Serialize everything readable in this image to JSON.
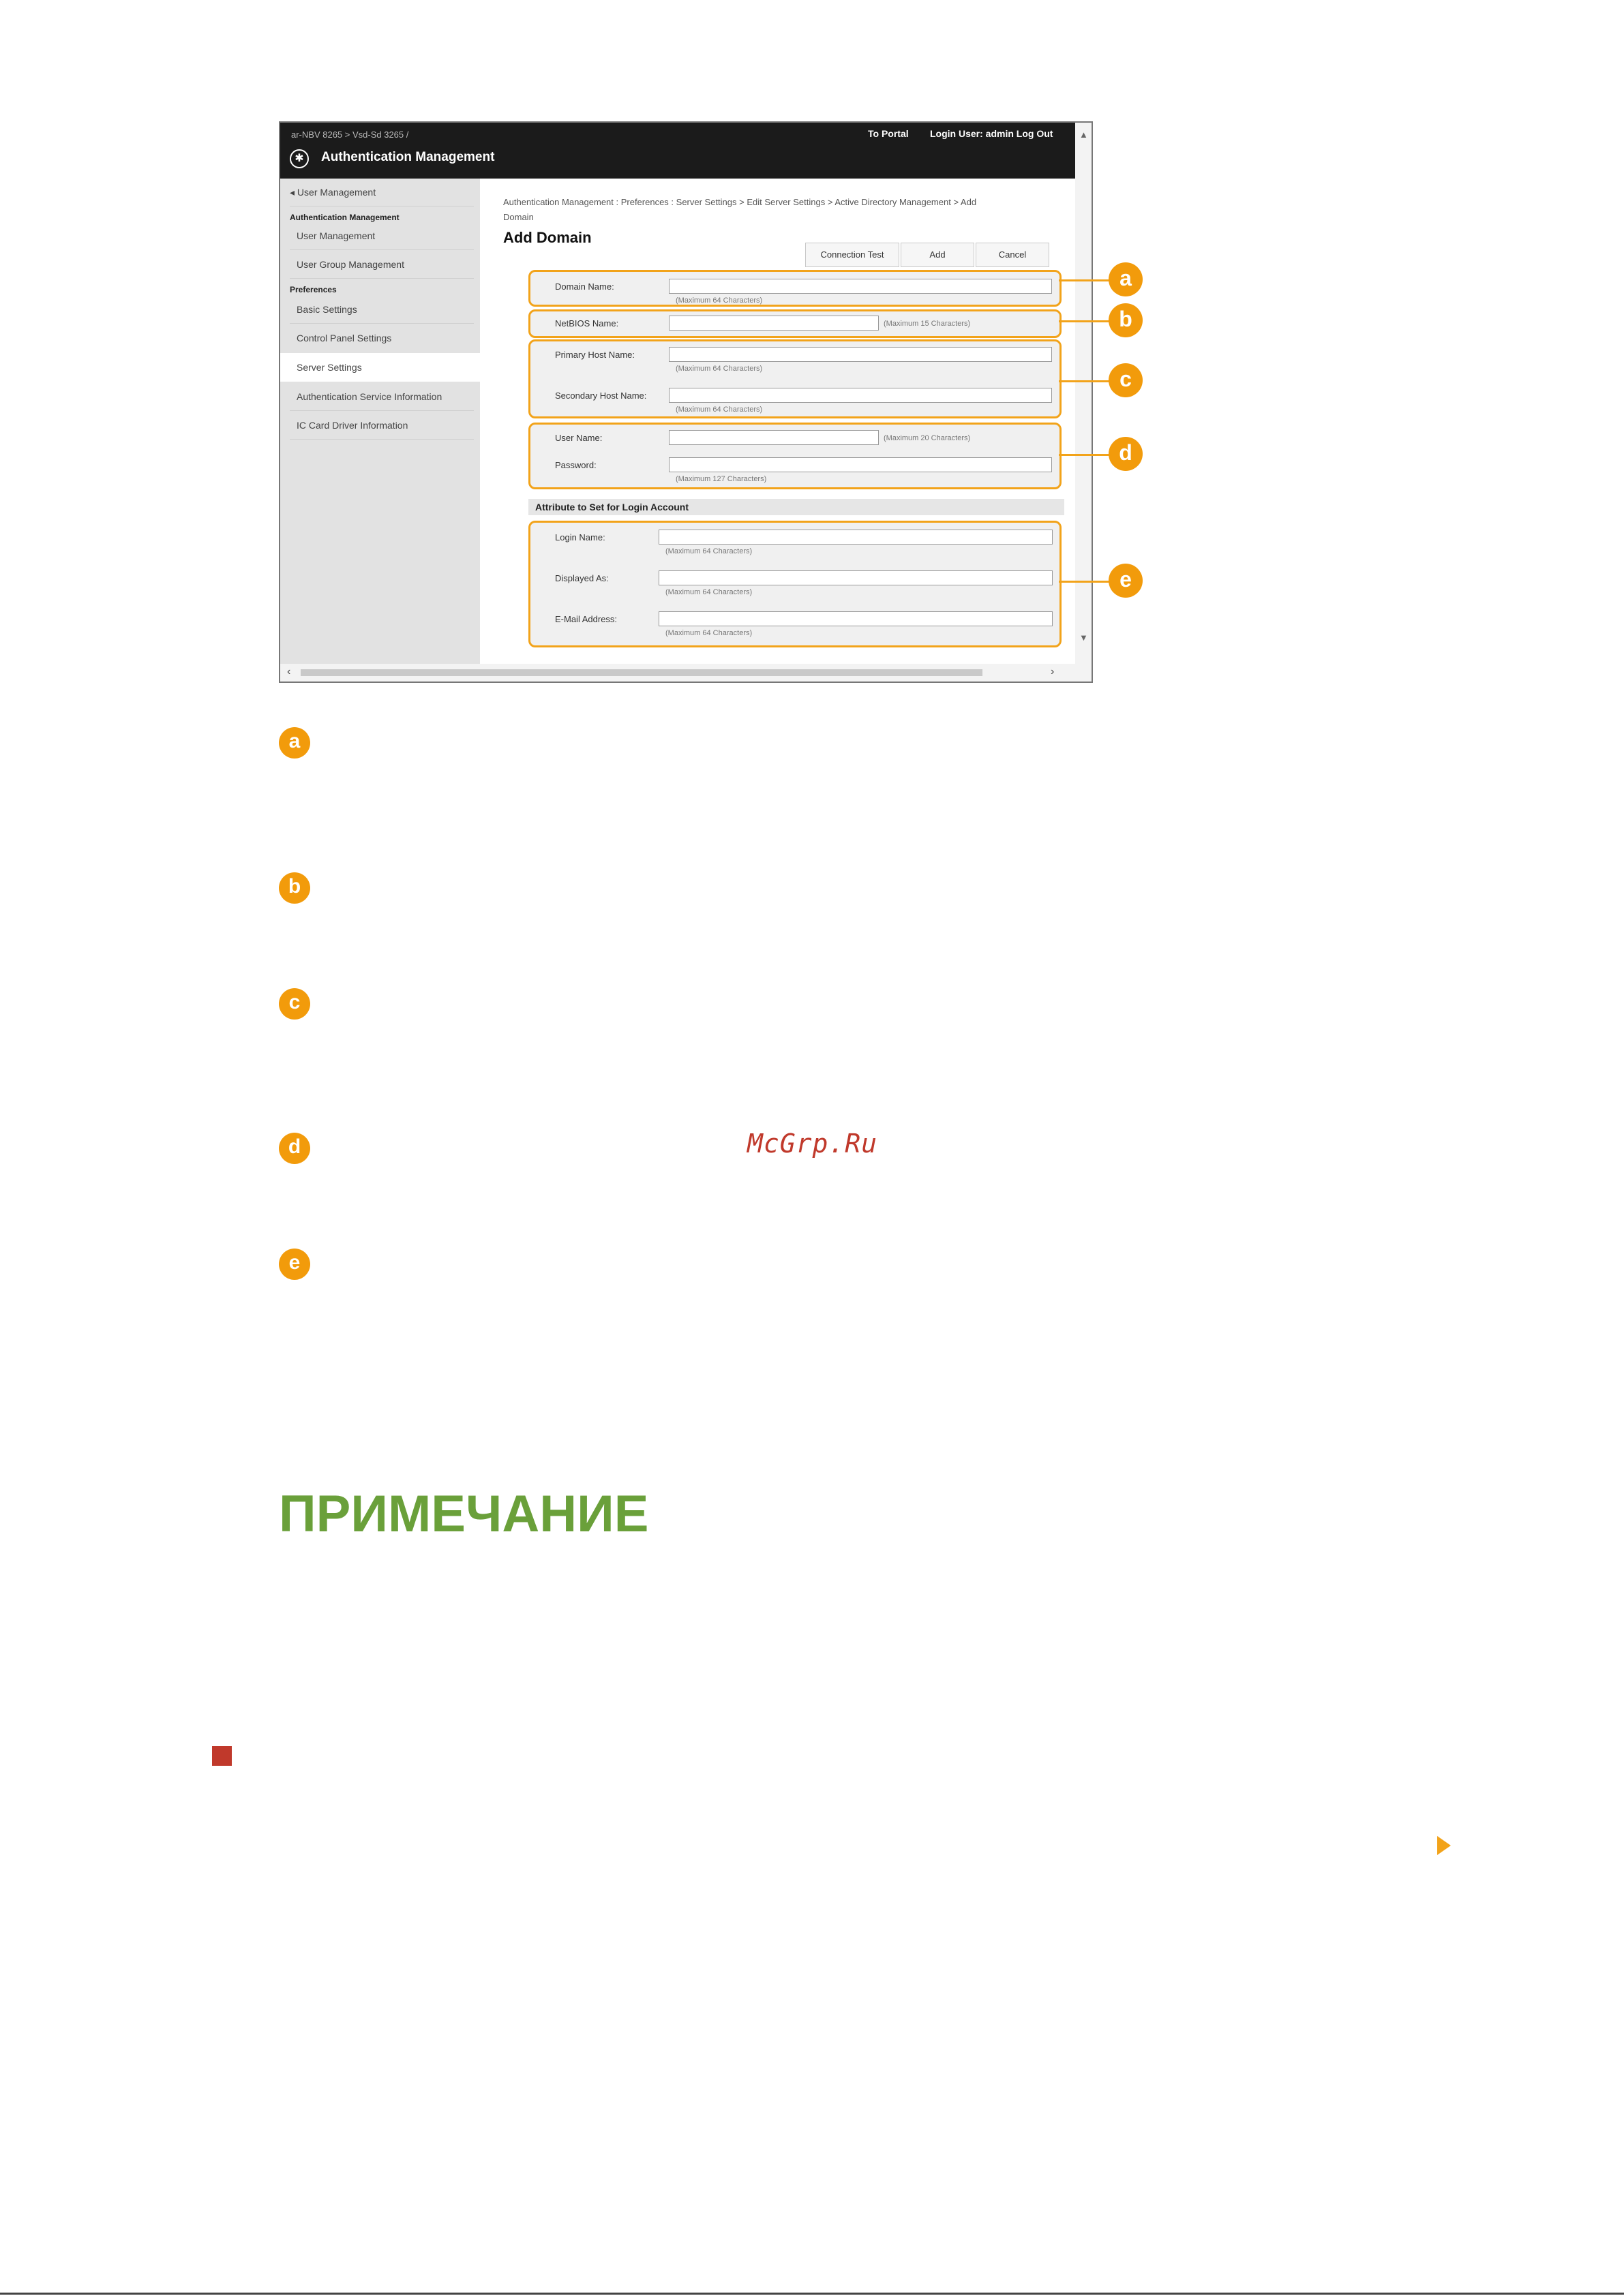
{
  "screenshot": {
    "topbar": {
      "crumb": "ar-NBV 8265 > Vsd-Sd 3265 /",
      "portal_link": "To Portal",
      "login_text": "Login User: admin Log Out",
      "app_title": "Authentication Management"
    },
    "sidebar": {
      "back_link": "User Management",
      "section_auth": "Authentication Management",
      "section_prefs": "Preferences",
      "items": [
        {
          "label": "User Management"
        },
        {
          "label": "User Group Management"
        },
        {
          "label": "Basic Settings"
        },
        {
          "label": "Control Panel Settings"
        },
        {
          "label": "Server Settings"
        },
        {
          "label": "Authentication Service Information"
        },
        {
          "label": "IC Card Driver Information"
        }
      ]
    },
    "main": {
      "breadcrumb": "Authentication Management : Preferences : Server Settings > Edit Server Settings > Active Directory Management > Add Domain",
      "title": "Add Domain",
      "buttons": {
        "connection_test": "Connection Test",
        "add": "Add",
        "cancel": "Cancel"
      },
      "fields": {
        "domain_name": {
          "label": "Domain Name:",
          "note": "(Maximum 64 Characters)"
        },
        "netbios_name": {
          "label": "NetBIOS Name:",
          "note": "(Maximum 15 Characters)"
        },
        "primary_host": {
          "label": "Primary Host Name:",
          "note": "(Maximum 64 Characters)"
        },
        "secondary_host": {
          "label": "Secondary Host Name:",
          "note": "(Maximum 64 Characters)"
        },
        "user_name": {
          "label": "User Name:",
          "note": "(Maximum 20 Characters)"
        },
        "password": {
          "label": "Password:",
          "note": "(Maximum 127 Characters)"
        },
        "login_name": {
          "label": "Login Name:",
          "note": "(Maximum 64 Characters)"
        },
        "displayed_as": {
          "label": "Displayed As:",
          "note": "(Maximum 64 Characters)"
        },
        "email": {
          "label": "E-Mail Address:",
          "note": "(Maximum 64 Characters)"
        }
      },
      "section_login_attr": "Attribute to Set for Login Account"
    },
    "callouts": [
      "a",
      "b",
      "c",
      "d",
      "e"
    ]
  },
  "document": {
    "markers": [
      "a",
      "b",
      "c",
      "d",
      "e"
    ],
    "watermark": "McGrp.Ru",
    "note_heading": "ПРИМЕЧАНИЕ"
  },
  "colors": {
    "accent": "#f29b0b",
    "note_green": "#6aa03a",
    "bullet_red": "#c0392b"
  }
}
